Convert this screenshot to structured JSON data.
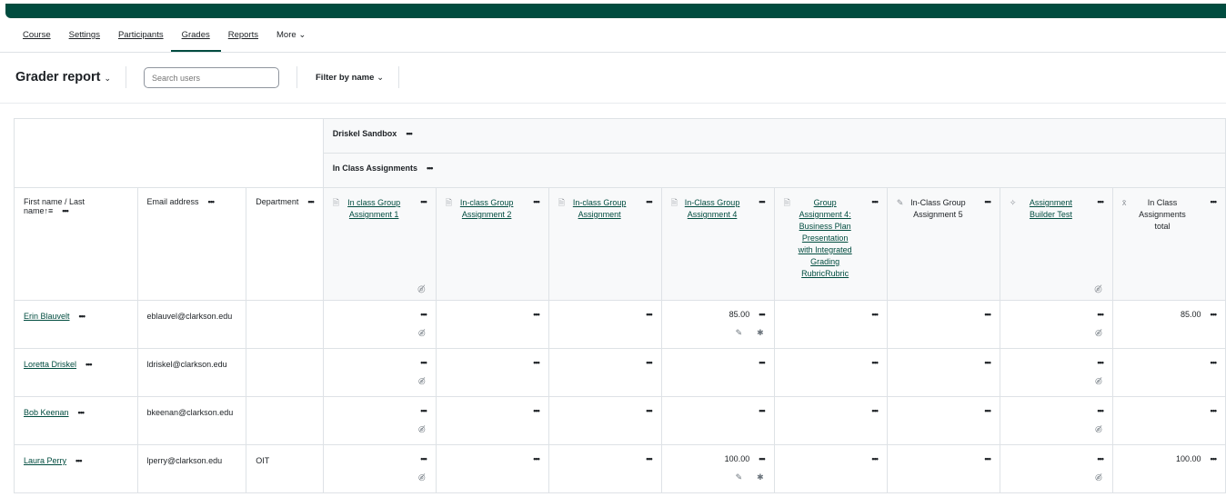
{
  "nav": {
    "items": [
      "Course",
      "Settings",
      "Participants",
      "Grades",
      "Reports"
    ],
    "active": "Grades",
    "more": "More"
  },
  "toolbar": {
    "title": "Grader report",
    "search_placeholder": "Search users",
    "filter": "Filter by name"
  },
  "categories": {
    "course": "Driskel Sandbox",
    "category": "In Class Assignments"
  },
  "columns": {
    "name": "First name / Last name",
    "email": "Email address",
    "department": "Department"
  },
  "grade_items": [
    {
      "label": "In class Group Assignment 1",
      "icon": "assignment",
      "link": true,
      "hidden": true
    },
    {
      "label": "In-class Group Assignment 2",
      "icon": "assignment",
      "link": true,
      "hidden": false
    },
    {
      "label": "In-class Group Assignment",
      "icon": "assignment",
      "link": true,
      "hidden": false
    },
    {
      "label": "In-Class Group Assignment 4",
      "icon": "assignment",
      "link": true,
      "hidden": false
    },
    {
      "label": "Group Assignment 4: Business Plan Presentation with Integrated Grading RubricRubric",
      "icon": "assignment",
      "link": true,
      "hidden": false
    },
    {
      "label": "In-Class Group Assignment 5",
      "icon": "manual",
      "link": false,
      "hidden": false
    },
    {
      "label": "Assignment Builder Test",
      "icon": "puzzle",
      "link": true,
      "hidden": true
    },
    {
      "label": "In Class Assignments total",
      "icon": "sum",
      "link": false,
      "hidden": false
    }
  ],
  "students": [
    {
      "name": "Erin Blauvelt",
      "email": "eblauvel@clarkson.edu",
      "department": "",
      "grades": [
        "",
        "",
        "",
        "85.00",
        "",
        "",
        "",
        "85.00"
      ],
      "overridden": true
    },
    {
      "name": "Loretta Driskel",
      "email": "ldriskel@clarkson.edu",
      "department": "",
      "grades": [
        "",
        "",
        "",
        "",
        "",
        "",
        "",
        ""
      ],
      "overridden": false
    },
    {
      "name": "Bob Keenan",
      "email": "bkeenan@clarkson.edu",
      "department": "",
      "grades": [
        "",
        "",
        "",
        "",
        "",
        "",
        "",
        ""
      ],
      "overridden": false
    },
    {
      "name": "Laura Perry",
      "email": "lperry@clarkson.edu",
      "department": "OIT",
      "grades": [
        "",
        "",
        "",
        "100.00",
        "",
        "",
        "",
        "100.00"
      ],
      "overridden": true
    }
  ],
  "colors": {
    "brand": "#004c3f"
  }
}
